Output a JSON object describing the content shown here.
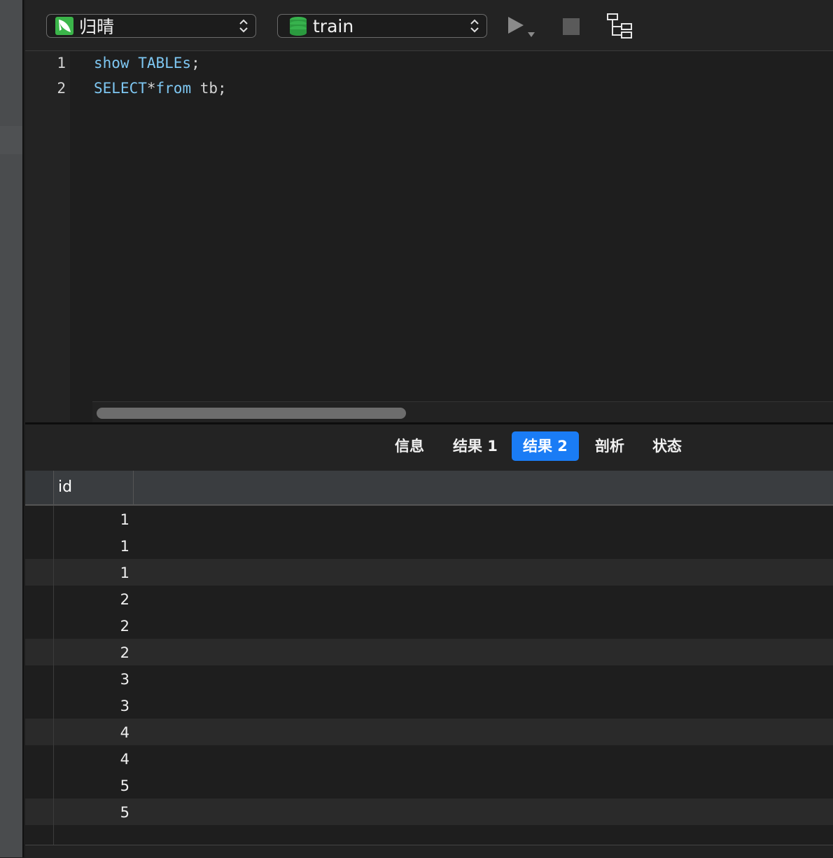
{
  "toolbar": {
    "connection": {
      "label": "归晴",
      "icon": "leaf-connection-icon",
      "icon_color": "#3bb54a"
    },
    "database": {
      "label": "train",
      "icon": "database-icon",
      "icon_color": "#2fa84f"
    },
    "run_icon": "play-icon",
    "stop_icon": "stop-icon",
    "explain_icon": "tree-icon"
  },
  "editor": {
    "lines": [
      {
        "number": "1",
        "tokens": [
          {
            "text": "show TABLEs",
            "kw": true
          },
          {
            "text": ";",
            "kw": false
          }
        ]
      },
      {
        "number": "2",
        "tokens": [
          {
            "text": "SELECT",
            "kw": true
          },
          {
            "text": "*",
            "kw": false
          },
          {
            "text": "from",
            "kw": true
          },
          {
            "text": " tb;",
            "kw": false
          }
        ]
      }
    ]
  },
  "result_tabs": [
    {
      "label": "信息",
      "active": false
    },
    {
      "label": "结果 1",
      "active": false
    },
    {
      "label": "结果 2",
      "active": true
    },
    {
      "label": "剖析",
      "active": false
    },
    {
      "label": "状态",
      "active": false
    }
  ],
  "grid": {
    "columns": [
      "id"
    ],
    "rows": [
      "1",
      "1",
      "1",
      "2",
      "2",
      "2",
      "3",
      "3",
      "4",
      "4",
      "5",
      "5"
    ]
  },
  "colors": {
    "accent": "#1a7cf5",
    "keyword": "#7ec7f2"
  }
}
